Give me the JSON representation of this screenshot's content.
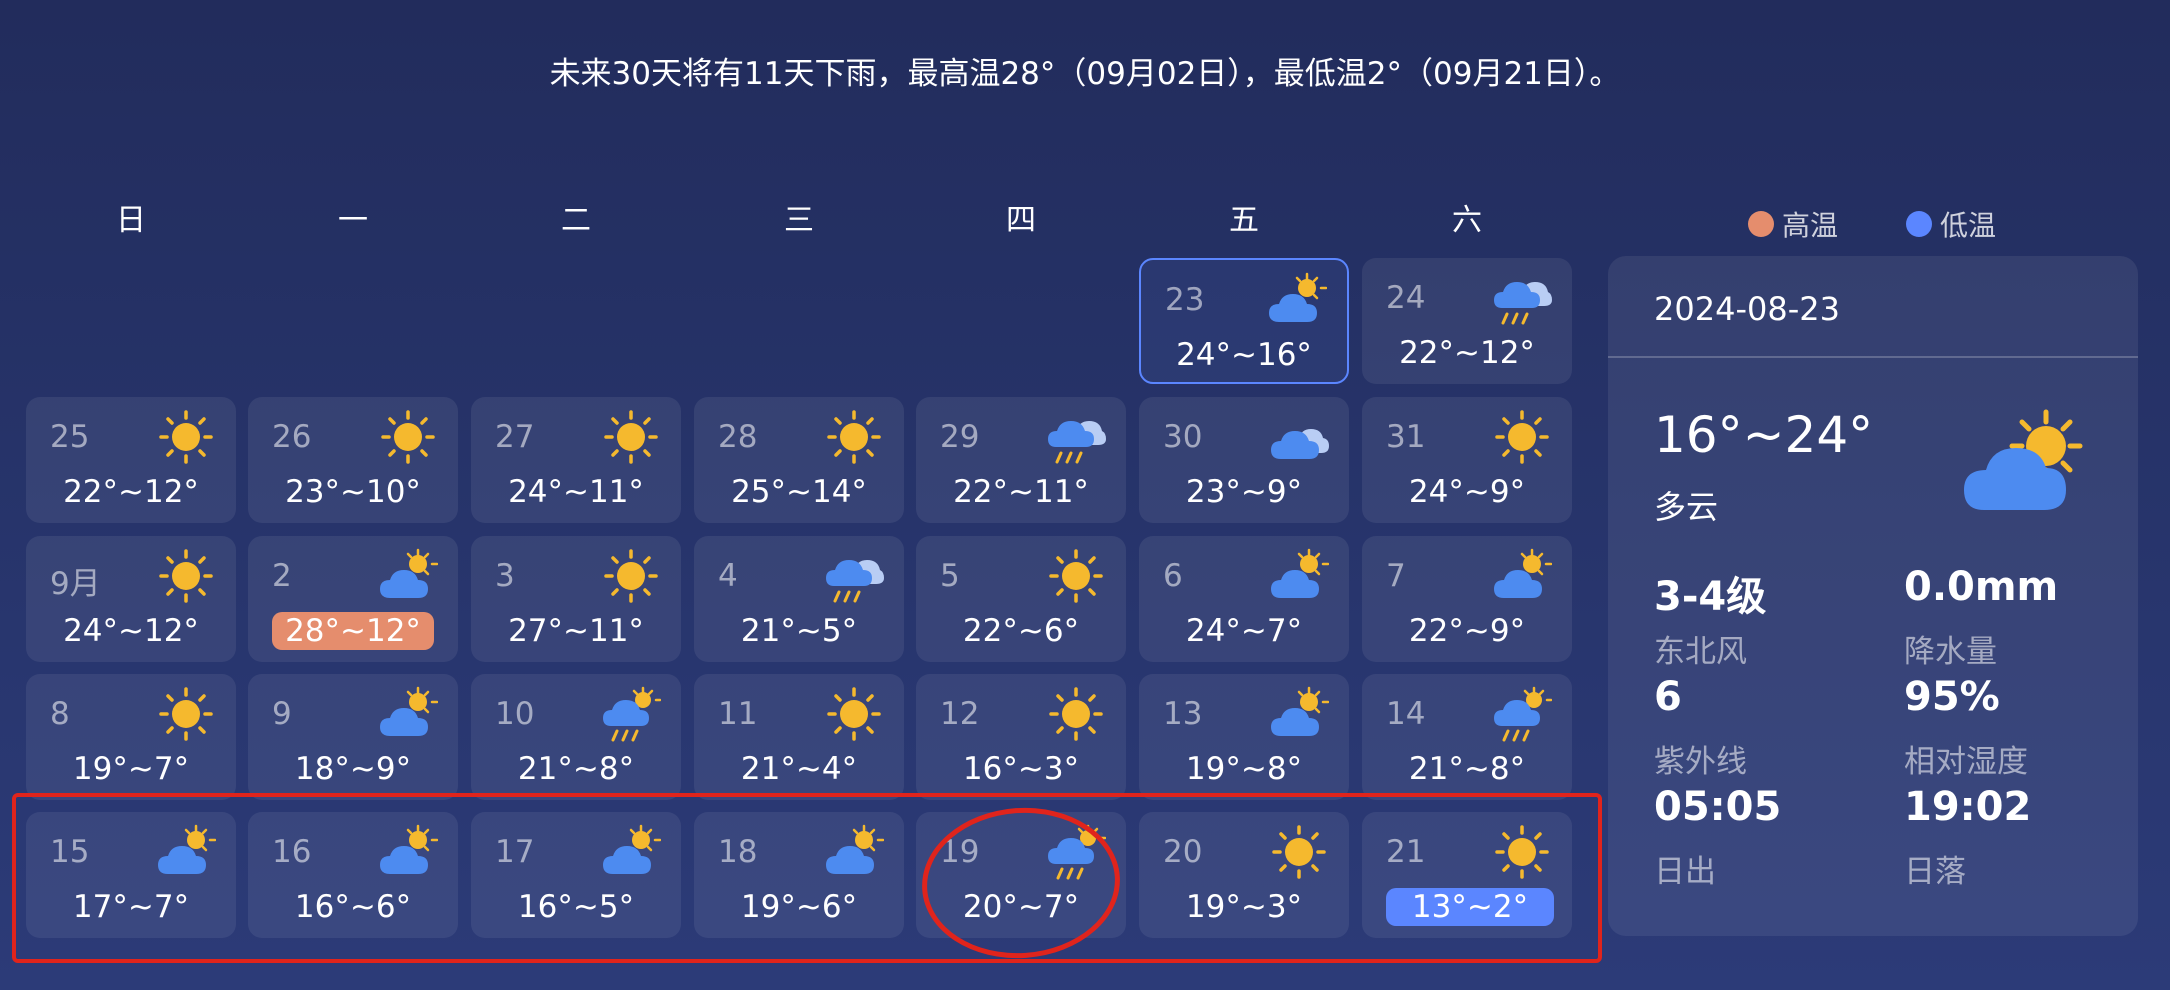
{
  "summary": "未来30天将有11天下雨，最高温28°（09月02日），最低温2°（09月21日）。",
  "weekdays": [
    "日",
    "一",
    "二",
    "三",
    "四",
    "五",
    "六"
  ],
  "legend": {
    "high_label": "高温",
    "high_color": "#e58d6d",
    "low_label": "低温",
    "low_color": "#5b86ff"
  },
  "calendar": [
    [
      null,
      null,
      null,
      null,
      null,
      {
        "day": "23",
        "temp": "24°~16°",
        "icon": "partly-cloudy-icon",
        "selected": true
      },
      {
        "day": "24",
        "temp": "22°~12°",
        "icon": "rain-icon"
      }
    ],
    [
      {
        "day": "25",
        "temp": "22°~12°",
        "icon": "sun-icon"
      },
      {
        "day": "26",
        "temp": "23°~10°",
        "icon": "sun-icon"
      },
      {
        "day": "27",
        "temp": "24°~11°",
        "icon": "sun-icon"
      },
      {
        "day": "28",
        "temp": "25°~14°",
        "icon": "sun-icon"
      },
      {
        "day": "29",
        "temp": "22°~11°",
        "icon": "rain-icon"
      },
      {
        "day": "30",
        "temp": "23°~9°",
        "icon": "cloud-icon"
      },
      {
        "day": "31",
        "temp": "24°~9°",
        "icon": "sun-icon"
      }
    ],
    [
      {
        "day": "9月",
        "temp": "24°~12°",
        "icon": "sun-icon"
      },
      {
        "day": "2",
        "temp": "28°~12°",
        "icon": "partly-cloudy-icon",
        "highlight": "high"
      },
      {
        "day": "3",
        "temp": "27°~11°",
        "icon": "sun-icon"
      },
      {
        "day": "4",
        "temp": "21°~5°",
        "icon": "rain-icon"
      },
      {
        "day": "5",
        "temp": "22°~6°",
        "icon": "sun-icon"
      },
      {
        "day": "6",
        "temp": "24°~7°",
        "icon": "partly-cloudy-icon"
      },
      {
        "day": "7",
        "temp": "22°~9°",
        "icon": "partly-cloudy-icon"
      }
    ],
    [
      {
        "day": "8",
        "temp": "19°~7°",
        "icon": "sun-icon"
      },
      {
        "day": "9",
        "temp": "18°~9°",
        "icon": "partly-cloudy-icon"
      },
      {
        "day": "10",
        "temp": "21°~8°",
        "icon": "sun-rain-icon"
      },
      {
        "day": "11",
        "temp": "21°~4°",
        "icon": "sun-icon"
      },
      {
        "day": "12",
        "temp": "16°~3°",
        "icon": "sun-icon"
      },
      {
        "day": "13",
        "temp": "19°~8°",
        "icon": "partly-cloudy-icon"
      },
      {
        "day": "14",
        "temp": "21°~8°",
        "icon": "sun-rain-icon"
      }
    ],
    [
      {
        "day": "15",
        "temp": "17°~7°",
        "icon": "partly-cloudy-icon"
      },
      {
        "day": "16",
        "temp": "16°~6°",
        "icon": "partly-cloudy-icon"
      },
      {
        "day": "17",
        "temp": "16°~5°",
        "icon": "partly-cloudy-icon"
      },
      {
        "day": "18",
        "temp": "19°~6°",
        "icon": "partly-cloudy-icon"
      },
      {
        "day": "19",
        "temp": "20°~7°",
        "icon": "sun-rain-icon"
      },
      {
        "day": "20",
        "temp": "19°~3°",
        "icon": "sun-icon"
      },
      {
        "day": "21",
        "temp": "13°~2°",
        "icon": "sun-icon",
        "highlight": "low"
      }
    ]
  ],
  "detail": {
    "date": "2024-08-23",
    "range": "16°~24°",
    "condition": "多云",
    "icon": "partly-cloudy-icon",
    "wind_value": "3-4级",
    "wind_label": "东北风",
    "precip_value": "0.0mm",
    "precip_label": "降水量",
    "uv_value": "6",
    "uv_label": "紫外线",
    "humidity_value": "95%",
    "humidity_label": "相对湿度",
    "sunrise_value": "05:05",
    "sunrise_label": "日出",
    "sunset_value": "19:02",
    "sunset_label": "日落"
  }
}
